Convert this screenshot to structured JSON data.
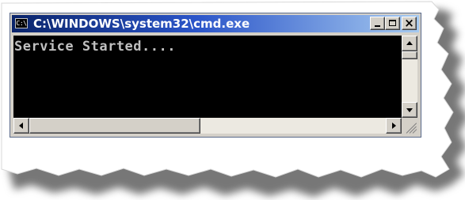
{
  "window": {
    "title": "C:\\WINDOWS\\system32\\cmd.exe",
    "icon_text": "C:\\",
    "icon": "console-app-icon",
    "title_gradient": [
      "#0a246a",
      "#a6caf0"
    ]
  },
  "caption_buttons": {
    "minimize_icon": "minimize-icon",
    "maximize_icon": "maximize-icon",
    "close_glyph": "×",
    "close_icon": "close-icon"
  },
  "console": {
    "output": "Service Started....",
    "background": "#000000",
    "text_color": "#c0c0c0"
  },
  "scrollbars": {
    "vertical": {
      "up_icon": "arrow-up-icon",
      "down_icon": "arrow-down-icon"
    },
    "horizontal": {
      "left_icon": "arrow-left-icon",
      "right_icon": "arrow-right-icon"
    }
  }
}
